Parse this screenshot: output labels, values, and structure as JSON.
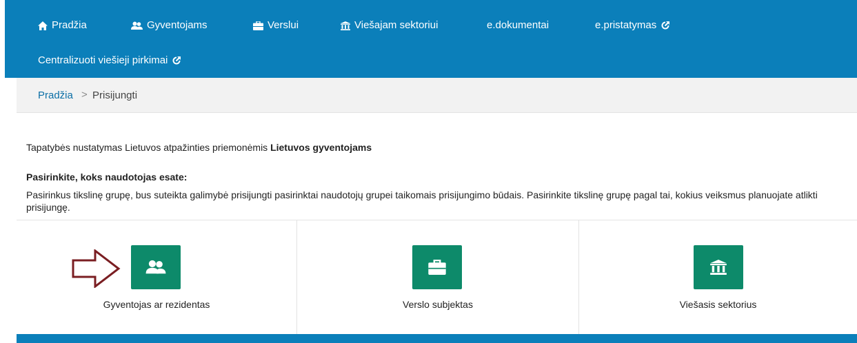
{
  "nav": {
    "items": [
      {
        "label": "Pradžia",
        "icon": "home-icon"
      },
      {
        "label": "Gyventojams",
        "icon": "users-icon"
      },
      {
        "label": "Verslui",
        "icon": "briefcase-icon"
      },
      {
        "label": "Viešajam sektoriui",
        "icon": "bank-icon"
      },
      {
        "label": "e.dokumentai",
        "icon": ""
      },
      {
        "label": "e.pristatymas",
        "icon": "external-link-icon"
      },
      {
        "label": "Centralizuoti viešieji pirkimai",
        "icon": "external-link-icon"
      }
    ],
    "background": "#0b7fba"
  },
  "breadcrumb": {
    "home": "Pradžia",
    "separator": ">",
    "current": "Prisijungti"
  },
  "content": {
    "intro_prefix": "Tapatybės nustatymas Lietuvos atpažinties priemonėmis ",
    "intro_bold": "Lietuvos gyventojams",
    "choose_title": "Pasirinkite, koks naudotojas esate:",
    "choose_desc": "Pasirinkus tikslinę grupę, bus suteikta galimybė prisijungti pasirinktai naudotojų grupei taikomais prisijungimo būdais. Pasirinkite tikslinę grupę pagal tai, kokius veiksmus planuojate atlikti prisijungę."
  },
  "groups": [
    {
      "label": "Gyventojas ar rezidentas",
      "icon": "users-icon"
    },
    {
      "label": "Verslo subjektas",
      "icon": "briefcase-icon"
    },
    {
      "label": "Viešasis sektorius",
      "icon": "bank-icon"
    }
  ],
  "colors": {
    "tile": "#0d8a6a",
    "link": "#0b6fa6",
    "arrow": "#7a1e22"
  }
}
